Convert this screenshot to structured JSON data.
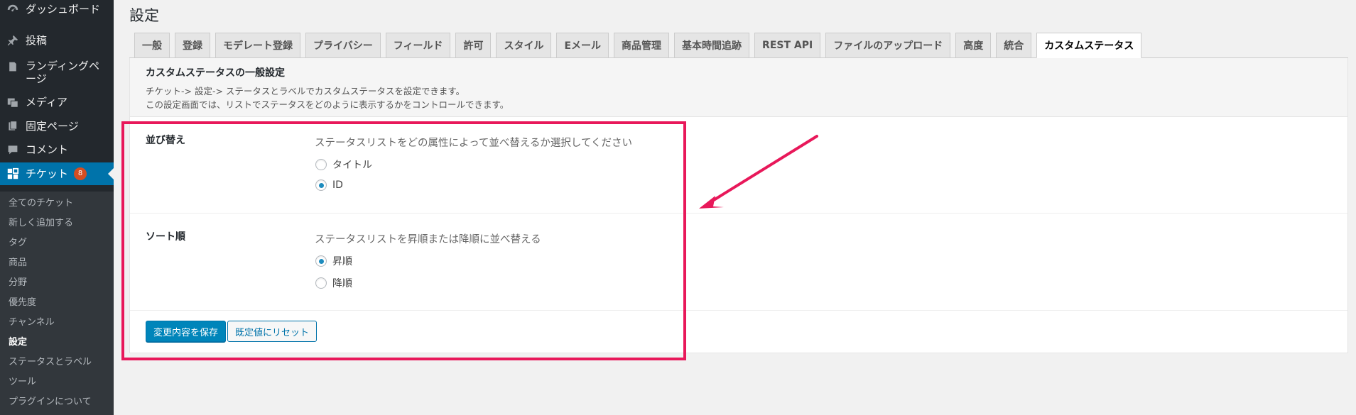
{
  "sidebar": {
    "items": [
      {
        "label": "ダッシュボード",
        "icon": "dashboard-icon"
      },
      {
        "label": "投稿",
        "icon": "pin-icon"
      },
      {
        "label": "ランディングページ",
        "icon": "page-icon"
      },
      {
        "label": "メディア",
        "icon": "media-icon"
      },
      {
        "label": "固定ページ",
        "icon": "pages-icon"
      },
      {
        "label": "コメント",
        "icon": "comment-icon"
      },
      {
        "label": "チケット",
        "icon": "tickets-icon",
        "badge": "8"
      }
    ],
    "submenu": [
      "全てのチケット",
      "新しく追加する",
      "タグ",
      "商品",
      "分野",
      "優先度",
      "チャンネル",
      "設定",
      "ステータスとラベル",
      "ツール",
      "プラグインについて"
    ]
  },
  "page": {
    "title": "設定"
  },
  "tabs": [
    "一般",
    "登録",
    "モデレート登録",
    "プライバシー",
    "フィールド",
    "許可",
    "スタイル",
    "Eメール",
    "商品管理",
    "基本時間追跡",
    "REST API",
    "ファイルのアップロード",
    "高度",
    "統合",
    "カスタムステータス"
  ],
  "section": {
    "title": "カスタムステータスの一般設定",
    "desc1": "チケット-> 設定-> ステータスとラベルでカスタムステータスを設定できます。",
    "desc2": "この設定画面では、リストでステータスをどのように表示するかをコントロールできます。"
  },
  "sort_by": {
    "label": "並び替え",
    "desc": "ステータスリストをどの属性によって並べ替えるか選択してください",
    "options": [
      "タイトル",
      "ID"
    ],
    "selected": "ID"
  },
  "sort_order": {
    "label": "ソート順",
    "desc": "ステータスリストを昇順または降順に並べ替える",
    "options": [
      "昇順",
      "降順"
    ],
    "selected": "昇順"
  },
  "buttons": {
    "save": "変更内容を保存",
    "reset": "既定値にリセット"
  },
  "colors": {
    "highlight": "#e8185a",
    "accent": "#0073aa"
  }
}
